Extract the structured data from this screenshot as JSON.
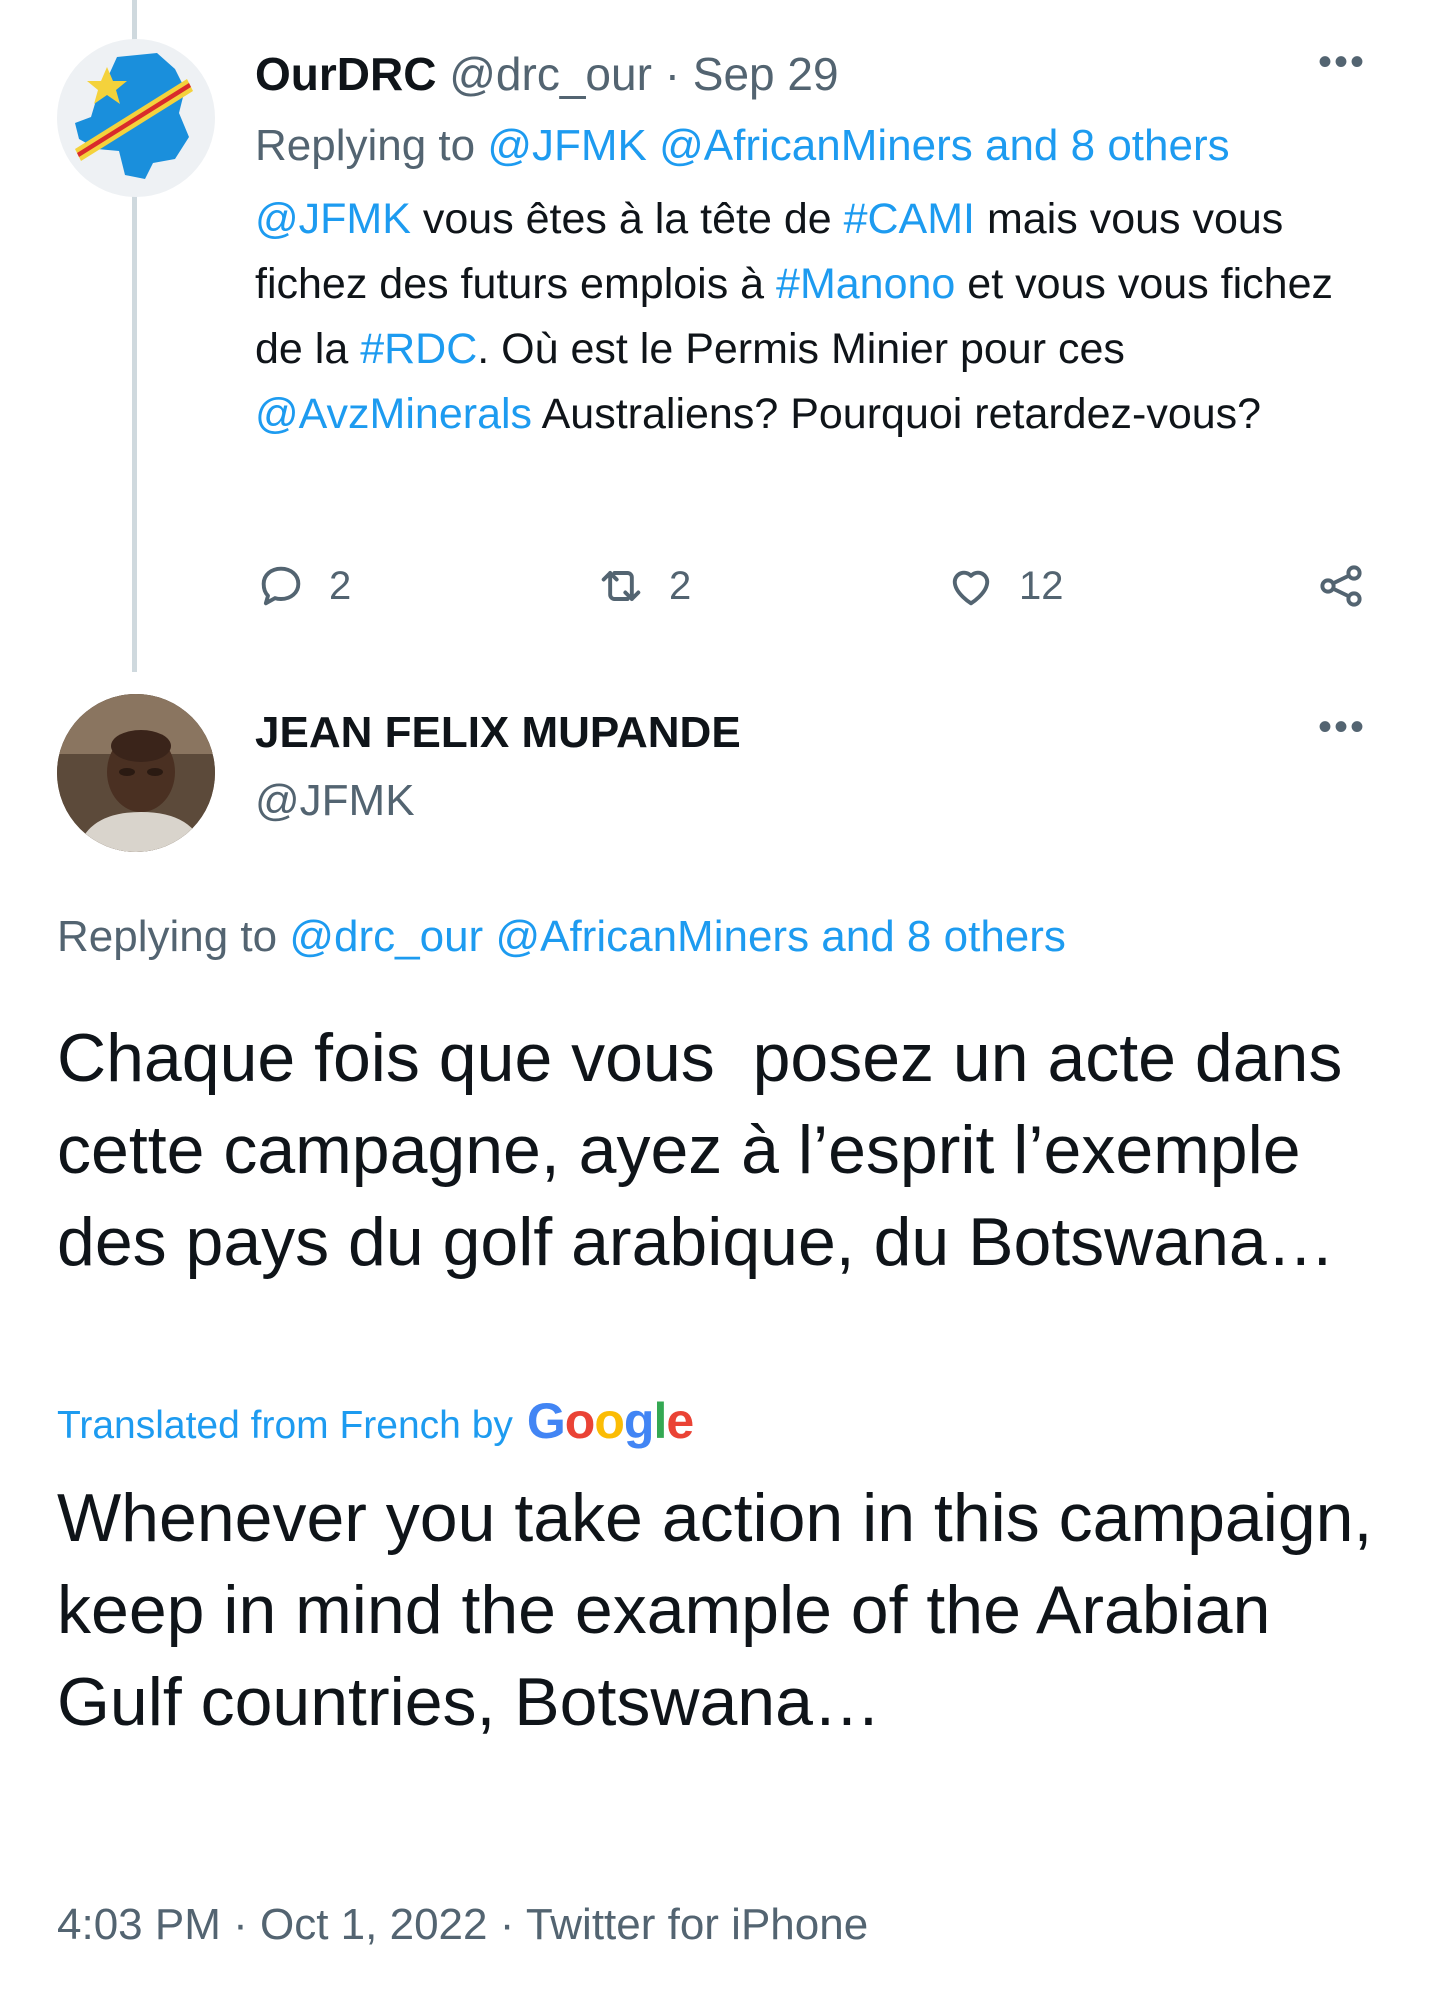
{
  "tweet1": {
    "display_name": "OurDRC",
    "handle": "@drc_our",
    "separator": "·",
    "date": "Sep 29",
    "replying_prefix": "Replying to ",
    "replying_to": "@JFMK @AfricanMiners and 8 others",
    "body": [
      {
        "text": "@JFMK",
        "link": true
      },
      {
        "text": " vous êtes à la tête de ",
        "link": false
      },
      {
        "text": "#CAMI",
        "link": true
      },
      {
        "text": " mais vous vous fichez des futurs emplois à ",
        "link": false
      },
      {
        "text": "#Manono",
        "link": true
      },
      {
        "text": " et vous vous fichez de la ",
        "link": false
      },
      {
        "text": "#RDC",
        "link": true
      },
      {
        "text": ". Où est le Permis Minier pour ces ",
        "link": false
      },
      {
        "text": "@AvzMinerals",
        "link": true
      },
      {
        "text": " Australiens? Pourquoi retardez-vous?",
        "link": false
      }
    ],
    "reply_count": "2",
    "retweet_count": "2",
    "like_count": "12",
    "more_icon": "more-horizontal-icon"
  },
  "tweet2": {
    "display_name": "JEAN FELIX MUPANDE",
    "handle": "@JFMK",
    "replying_prefix": "Replying to ",
    "replying_to": "@drc_our @AfricanMiners and 8 others",
    "body": "Chaque fois que vous  posez un acte dans cette campagne, ayez à l’esprit l’exemple des pays du golf arabique, du Botswana…",
    "translated_label": "Translated from French by",
    "translator": "Google",
    "translation": "Whenever you take action in this campaign, keep in mind the example of the Arabian Gulf countries, Botswana…",
    "time": "4:03 PM",
    "date": "Oct 1, 2022",
    "source": "Twitter for iPhone",
    "separator": "·"
  },
  "colors": {
    "link": "#1d9bf0",
    "muted": "#536471",
    "text": "#0f1419",
    "thread_line": "#cfd9de"
  }
}
